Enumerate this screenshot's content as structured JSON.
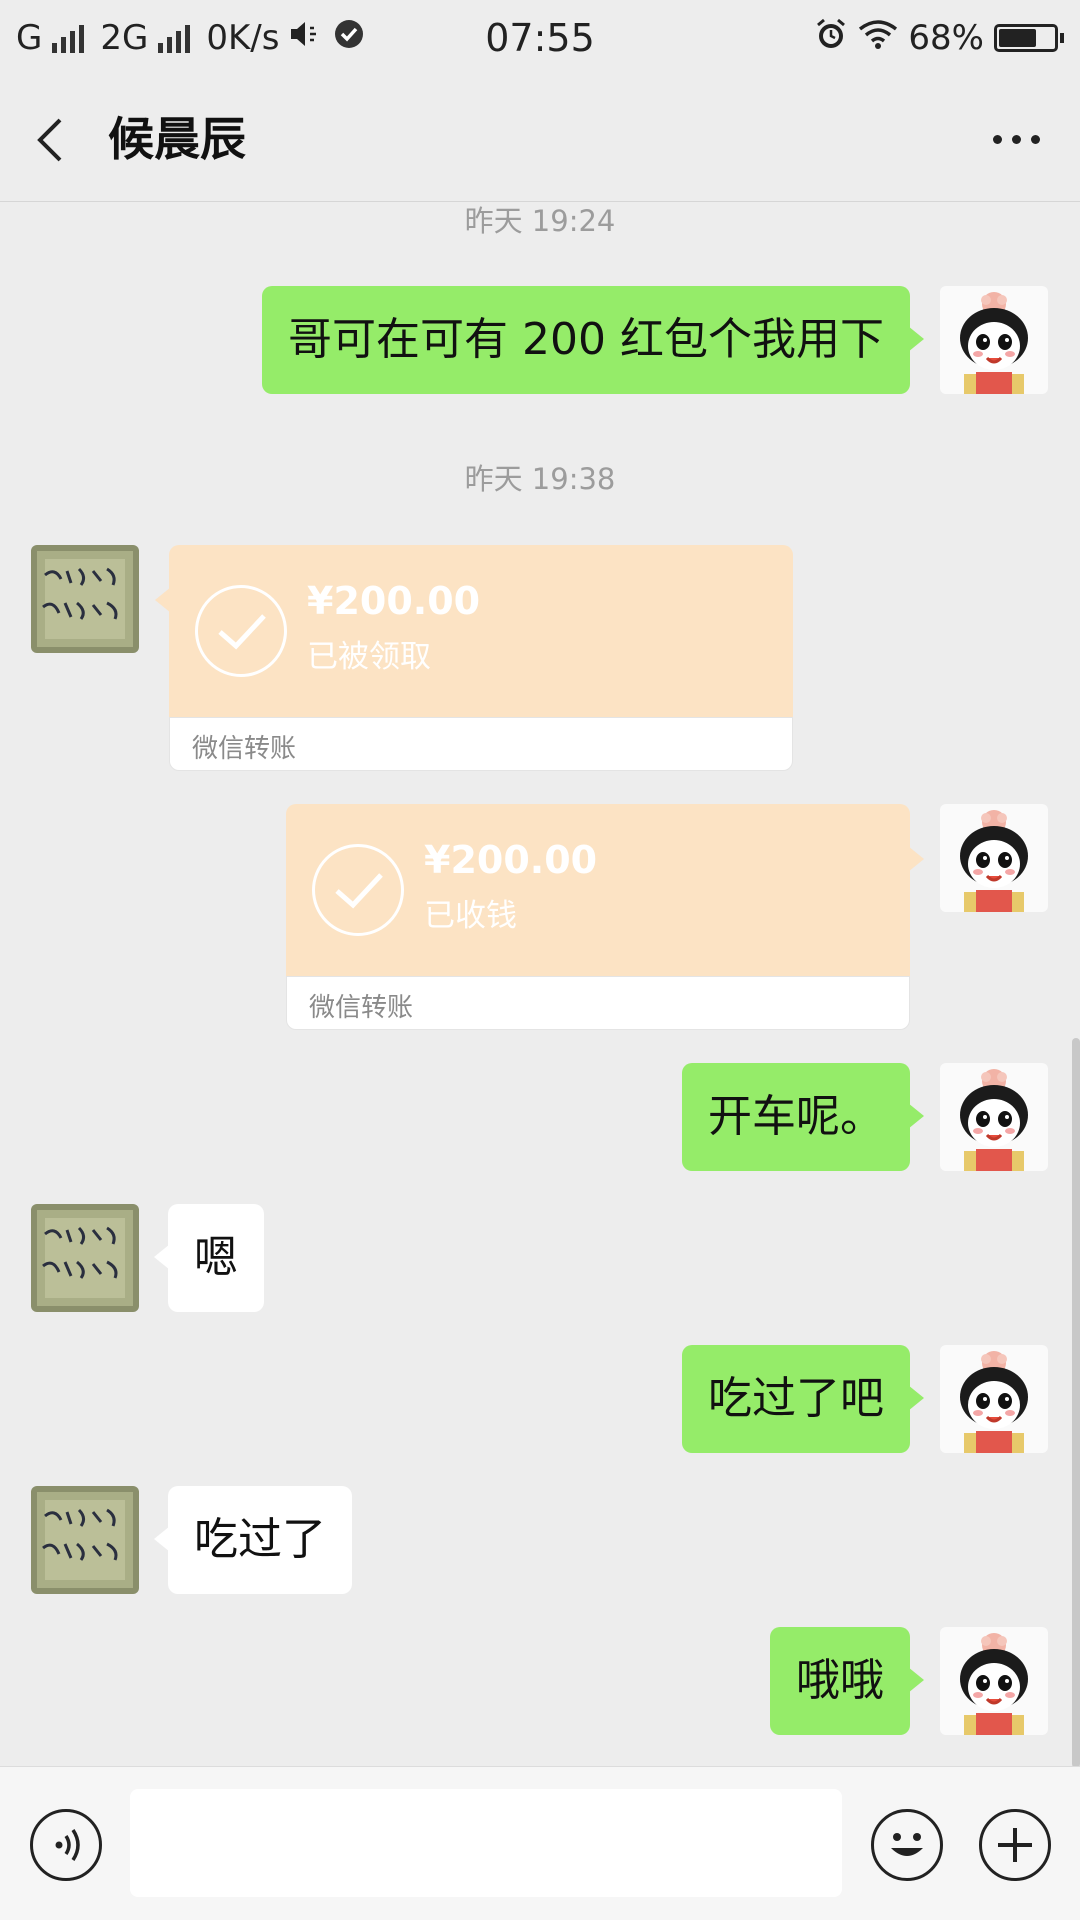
{
  "status_bar": {
    "carrier1": "G",
    "carrier2": "2G",
    "speed": "0K/s",
    "time": "07:55",
    "battery": "68%",
    "battery_level": 0.68
  },
  "header": {
    "title": "候晨辰"
  },
  "messages": {
    "ts1": "昨天 19:24",
    "m1": "哥可在可有 200 红包个我用下",
    "ts2": "昨天 19:38",
    "t1": {
      "amount": "¥200.00",
      "status": "已被领取",
      "label": "微信转账"
    },
    "t2": {
      "amount": "¥200.00",
      "status": "已收钱",
      "label": "微信转账"
    },
    "m2": "开车呢。",
    "m3": "嗯",
    "m4": "吃过了吧",
    "m5": "吃过了",
    "m6": "哦哦"
  },
  "input": {
    "placeholder": ""
  },
  "colors": {
    "self_bubble": "#95ec69",
    "other_bubble": "#ffffff",
    "transfer": "#fce3c4",
    "background": "#ededed"
  }
}
